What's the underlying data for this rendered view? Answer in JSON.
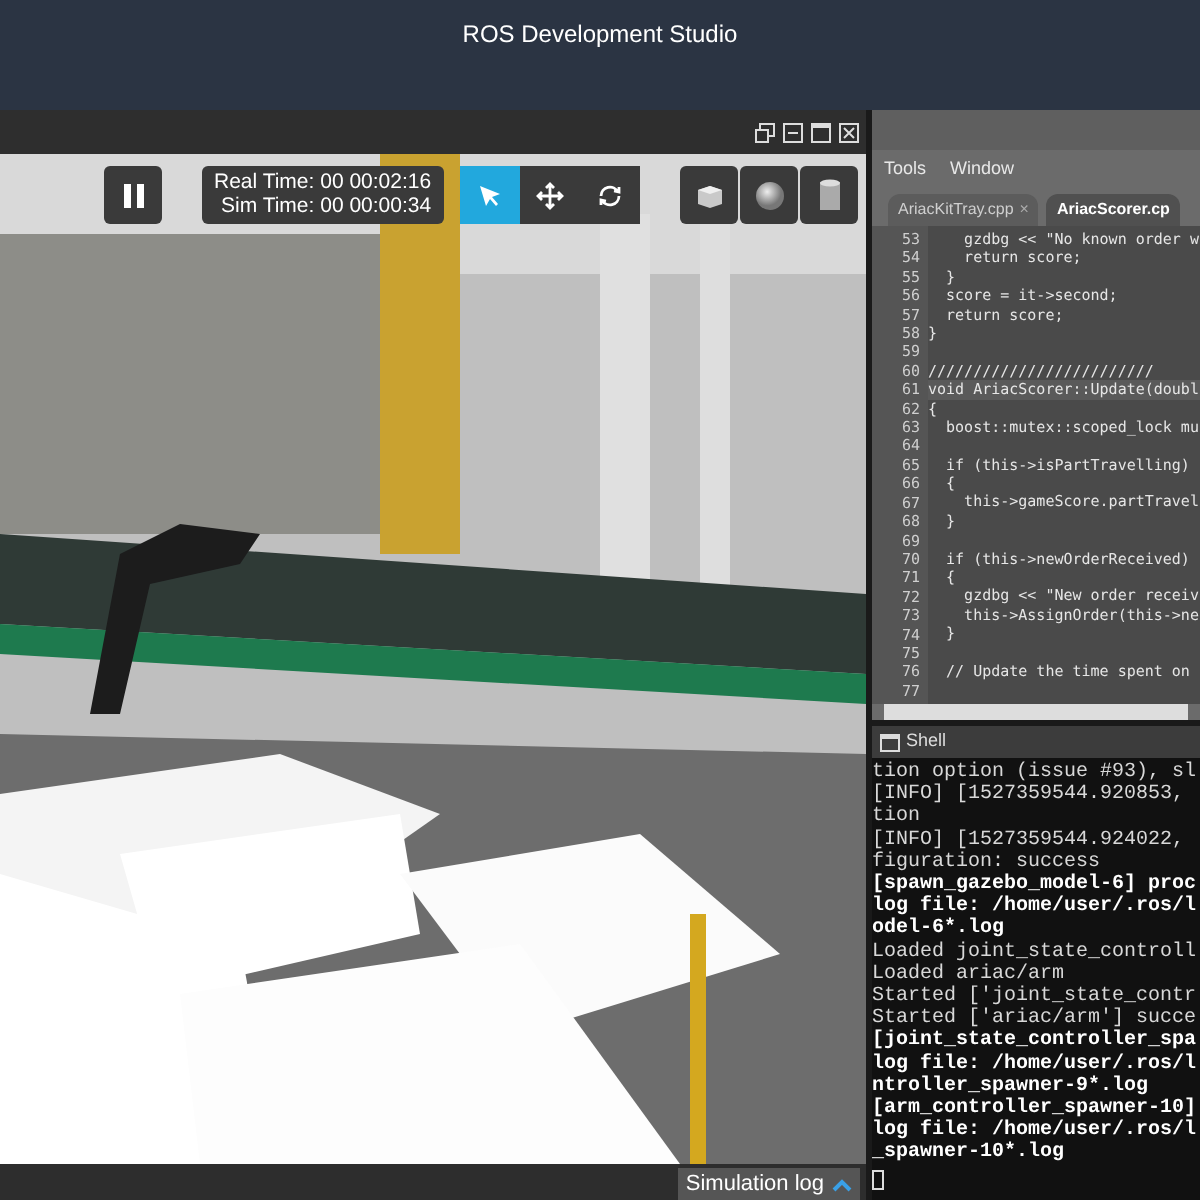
{
  "app_title": "ROS Development Studio",
  "simulation": {
    "real_time": "Real Time: 00 00:02:16",
    "sim_time": "Sim Time: 00 00:00:34",
    "paused": false,
    "tools": [
      {
        "kind": "select",
        "selected": true
      },
      {
        "kind": "translate",
        "selected": false
      },
      {
        "kind": "rotate",
        "selected": false
      }
    ],
    "shapes": [
      {
        "kind": "box"
      },
      {
        "kind": "sphere"
      },
      {
        "kind": "cylinder"
      }
    ],
    "log_label": "Simulation log"
  },
  "editor": {
    "menu": [
      "Tools",
      "Window"
    ],
    "tabs": [
      {
        "label": "AriacKitTray.cpp",
        "selected": false,
        "close": "×"
      },
      {
        "label": "AriacScorer.cp",
        "selected": true
      }
    ],
    "lines": [
      {
        "number": "53",
        "text": "    gzdbg << \"No known order w",
        "selected": false
      },
      {
        "number": "54",
        "text": "    return score;",
        "selected": false
      },
      {
        "number": "55",
        "text": "  }",
        "selected": false
      },
      {
        "number": "56",
        "text": "  score = it->second;",
        "selected": false
      },
      {
        "number": "57",
        "text": "  return score;",
        "selected": false
      },
      {
        "number": "58",
        "text": "}",
        "selected": false
      },
      {
        "number": "59",
        "selected": false
      },
      {
        "number": "60",
        "text": "/////////////////////////",
        "selected": false
      },
      {
        "number": "61",
        "text": "void AriacScorer::Update(doubl",
        "selected": true
      },
      {
        "number": "62",
        "text": "{",
        "selected": false
      },
      {
        "number": "63",
        "text": "  boost::mutex::scoped_lock mu",
        "selected": false
      },
      {
        "number": "64",
        "selected": false
      },
      {
        "number": "65",
        "text": "  if (this->isPartTravelling)",
        "selected": false
      },
      {
        "number": "66",
        "text": "  {",
        "selected": false
      },
      {
        "number": "67",
        "text": "    this->gameScore.partTravel",
        "selected": false
      },
      {
        "number": "68",
        "text": "  }",
        "selected": false
      },
      {
        "number": "69",
        "selected": false
      },
      {
        "number": "70",
        "text": "  if (this->newOrderReceived)",
        "selected": false
      },
      {
        "number": "71",
        "text": "  {",
        "selected": false
      },
      {
        "number": "72",
        "text": "    gzdbg << \"New order receiv",
        "selected": false
      },
      {
        "number": "73",
        "text": "    this->AssignOrder(this->ne",
        "selected": false
      },
      {
        "number": "74",
        "text": "  }",
        "selected": false
      },
      {
        "number": "75",
        "selected": false
      },
      {
        "number": "76",
        "text": "  // Update the time spent on",
        "selected": false
      },
      {
        "number": "77",
        "selected": false
      }
    ]
  },
  "shell": {
    "title": "Shell",
    "lines": [
      {
        "text": "tion option (issue #93), sl",
        "bold": false
      },
      {
        "text": "[INFO] [1527359544.920853, ",
        "bold": false
      },
      {
        "text": "tion",
        "bold": false
      },
      {
        "text": "[INFO] [1527359544.924022, ",
        "bold": false
      },
      {
        "text": "figuration: success",
        "bold": false
      },
      {
        "text": "[spawn_gazebo_model-6] proc",
        "bold": true
      },
      {
        "text": "log file: /home/user/.ros/l",
        "bold": true
      },
      {
        "text": "odel-6*.log",
        "bold": true
      },
      {
        "text": "Loaded joint_state_controll",
        "bold": false
      },
      {
        "text": "Loaded ariac/arm",
        "bold": false
      },
      {
        "text": "Started ['joint_state_contr",
        "bold": false
      },
      {
        "text": "Started ['ariac/arm'] succe",
        "bold": false
      },
      {
        "text": "[joint_state_controller_spa",
        "bold": true
      },
      {
        "text": "log file: /home/user/.ros/l",
        "bold": true
      },
      {
        "text": "ntroller_spawner-9*.log",
        "bold": true
      },
      {
        "text": "[arm_controller_spawner-10]",
        "bold": true
      },
      {
        "text": "log file: /home/user/.ros/l",
        "bold": true
      },
      {
        "text": "_spawner-10*.log",
        "bold": true
      }
    ]
  }
}
